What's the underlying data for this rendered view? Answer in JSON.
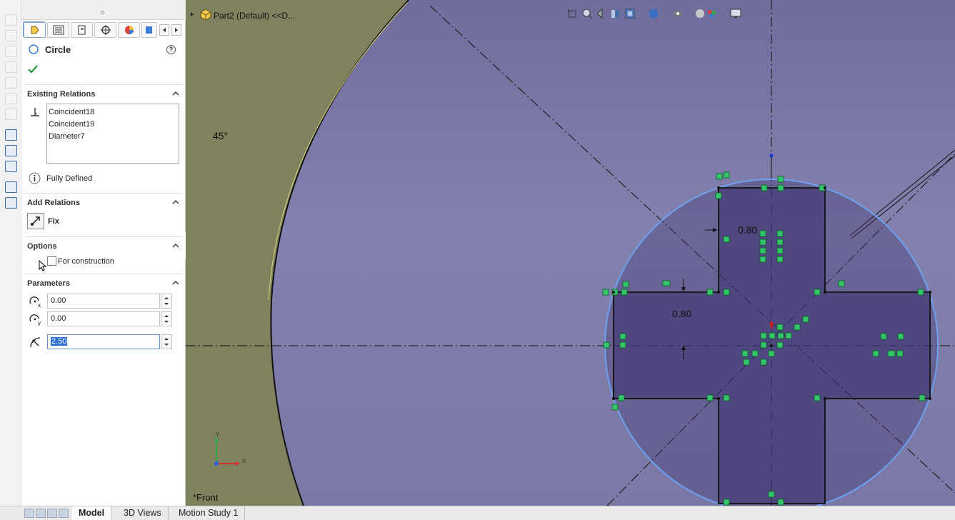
{
  "doc_title": "Part2 (Default) <<D...",
  "property_manager": {
    "title": "Circle",
    "help_symbol": "?",
    "existing_relations": {
      "heading": "Existing Relations",
      "items": [
        "Coincident18",
        "Coincident19",
        "Diameter7"
      ],
      "status": "Fully Defined"
    },
    "add_relations": {
      "heading": "Add Relations",
      "fix_label": "Fix"
    },
    "options": {
      "heading": "Options",
      "for_construction": "For construction",
      "for_construction_checked": false
    },
    "parameters": {
      "heading": "Parameters",
      "cx_value": "0.00",
      "cy_value": "0.00",
      "radius_value": "2.50"
    }
  },
  "canvas": {
    "angle_label": "45°",
    "dim_top": "0.80",
    "dim_left": "0.80",
    "view_label": "*Front",
    "triad_y": "Y",
    "triad_x": "X",
    "colors": {
      "background": "#7a78a6",
      "surface": "#7f8163",
      "circle": "#6ea0f0",
      "relation": "#34c46a"
    }
  },
  "bottom_tabs": [
    "Model",
    "3D Views",
    "Motion Study 1"
  ]
}
